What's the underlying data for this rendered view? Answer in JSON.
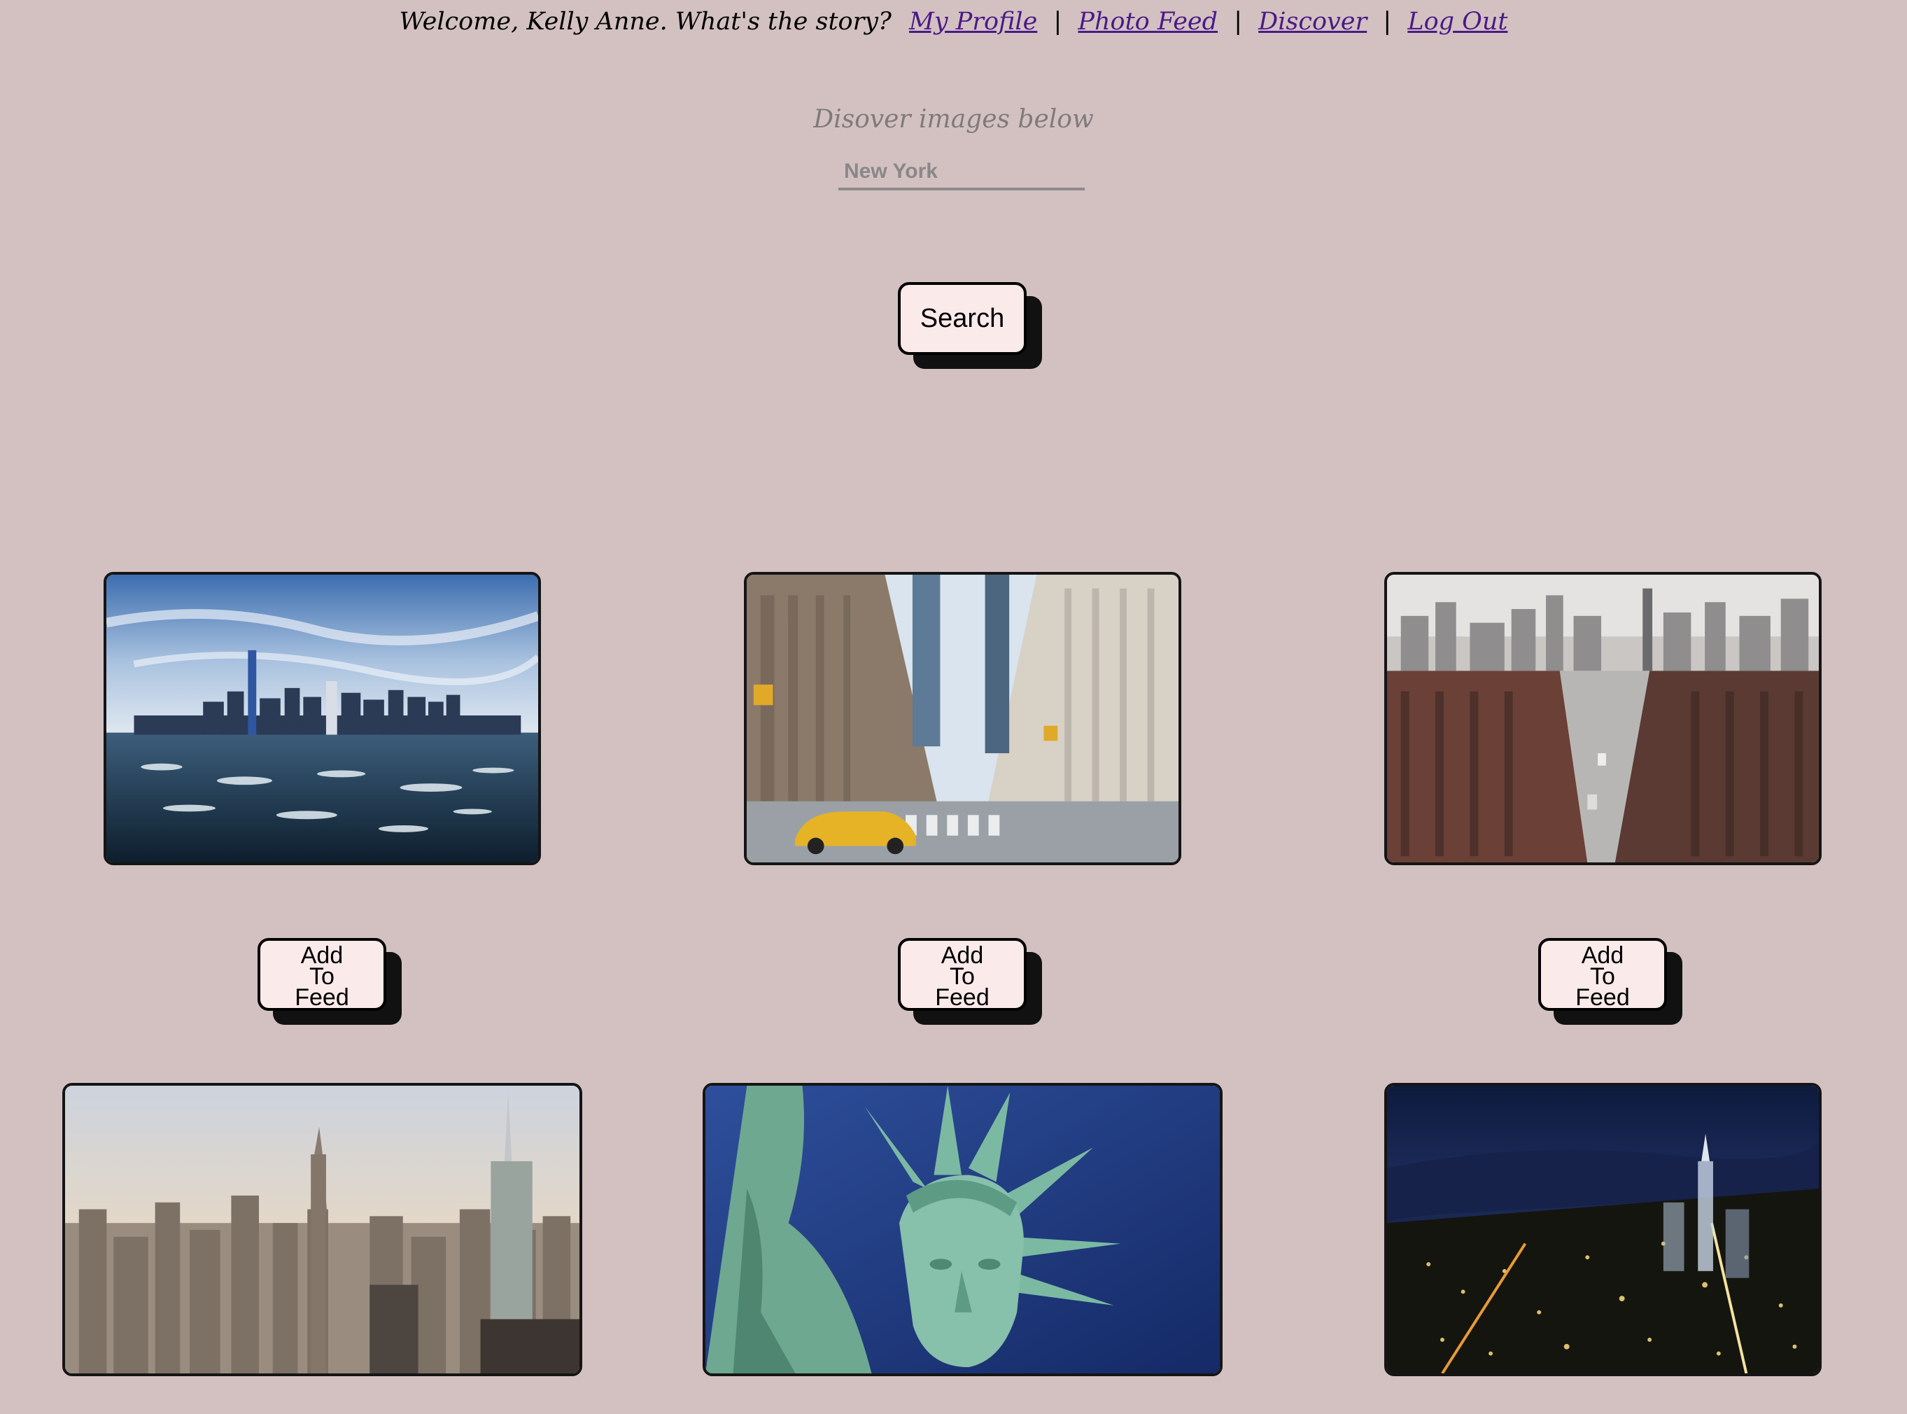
{
  "nav": {
    "welcome": "Welcome, Kelly Anne. What's the story?",
    "links": [
      "My Profile",
      "Photo Feed",
      "Discover",
      "Log Out"
    ],
    "separator": "|"
  },
  "discover": {
    "prompt": "Disover images below",
    "search_value": "New York",
    "search_button": "Search"
  },
  "results": {
    "add_label_lines": [
      "Add",
      "To",
      "Feed"
    ],
    "images": [
      {
        "subject": "Manhattan skyline over icy harbor"
      },
      {
        "subject": "Midtown avenue with yellow taxi"
      },
      {
        "subject": "Aerial street view of city blocks"
      },
      {
        "subject": "Hazy skyline with Empire State Building"
      },
      {
        "subject": "Statue of Liberty crown"
      },
      {
        "subject": "Night aerial of lower Manhattan"
      }
    ]
  },
  "colors": {
    "background": "#d3c1c2",
    "link": "#4b1a85",
    "button_fill": "#fbeaea",
    "button_shadow": "#111111"
  }
}
